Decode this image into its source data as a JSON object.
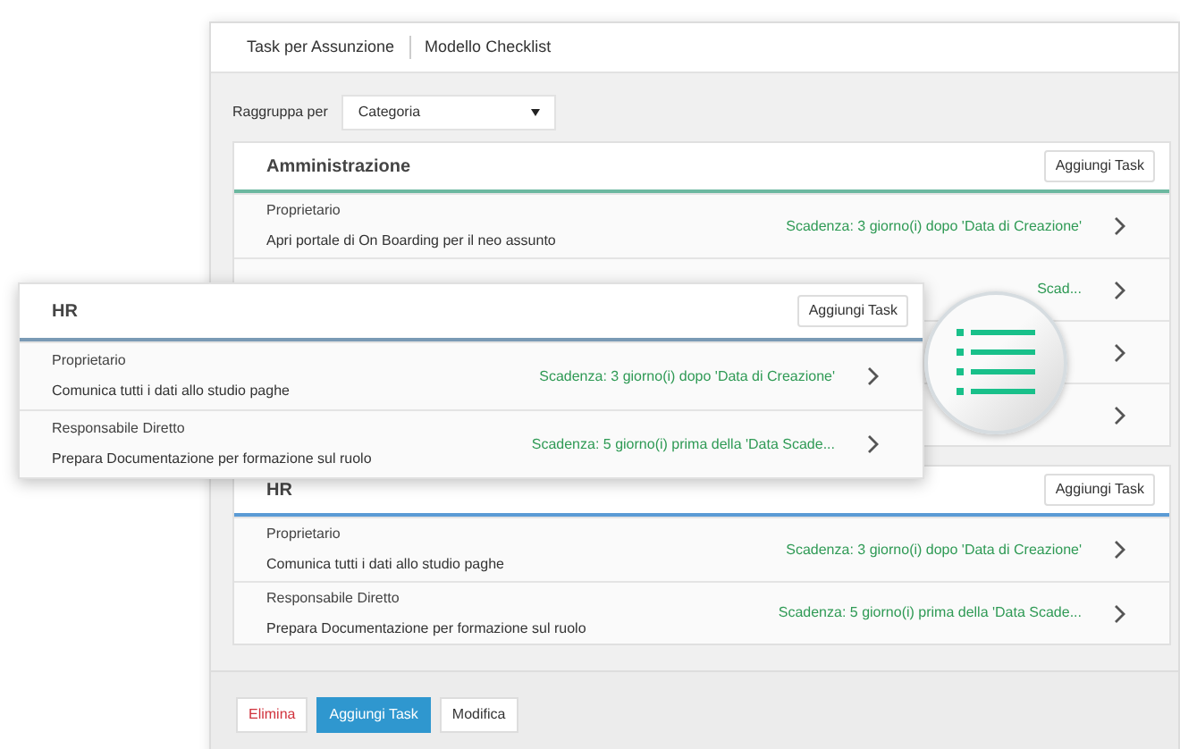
{
  "tabs": [
    {
      "label": "Task per Assunzione"
    },
    {
      "label": "Modello Checklist"
    }
  ],
  "group_by": {
    "label": "Raggruppa per",
    "value": "Categoria"
  },
  "groups": [
    {
      "title": "Amministrazione",
      "color": "#6cb8a0",
      "button": "Aggiungi Task",
      "tasks": [
        {
          "kind": "full",
          "owner": "Proprietario",
          "description": "Apri portale di On Boarding per il neo assunto",
          "due": "Scadenza: 3 giorno(i) dopo 'Data di Creazione'"
        },
        {
          "kind": "covered",
          "due": "Scad..."
        },
        {
          "kind": "covered"
        },
        {
          "kind": "covered"
        }
      ]
    },
    {
      "title": "HR",
      "color": "#5b9bd5",
      "button": "Aggiungi Task",
      "tasks": [
        {
          "owner": "Proprietario",
          "description": "Comunica tutti i dati allo studio paghe",
          "due": "Scadenza: 3 giorno(i) dopo 'Data di Creazione'"
        },
        {
          "owner": "Responsabile Diretto",
          "description": "Prepara Documentazione per formazione sul ruolo",
          "due": "Scadenza: 5 giorno(i) prima della 'Data Scade..."
        }
      ]
    }
  ],
  "callout": {
    "title": "HR",
    "color": "#7a9ab5",
    "button": "Aggiungi Task",
    "tasks": [
      {
        "owner": "Proprietario",
        "description": "Comunica tutti i dati allo studio paghe",
        "due": "Scadenza: 3 giorno(i) dopo 'Data di Creazione'"
      },
      {
        "owner": "Responsabile Diretto",
        "description": "Prepara Documentazione per formazione sul ruolo",
        "due": "Scadenza: 5 giorno(i) prima della 'Data Scade..."
      }
    ]
  },
  "footer_buttons": [
    {
      "label": "Elimina",
      "kind": "danger"
    },
    {
      "label": "Aggiungi Task",
      "kind": "primary"
    },
    {
      "label": "Modifica",
      "kind": "default"
    }
  ]
}
